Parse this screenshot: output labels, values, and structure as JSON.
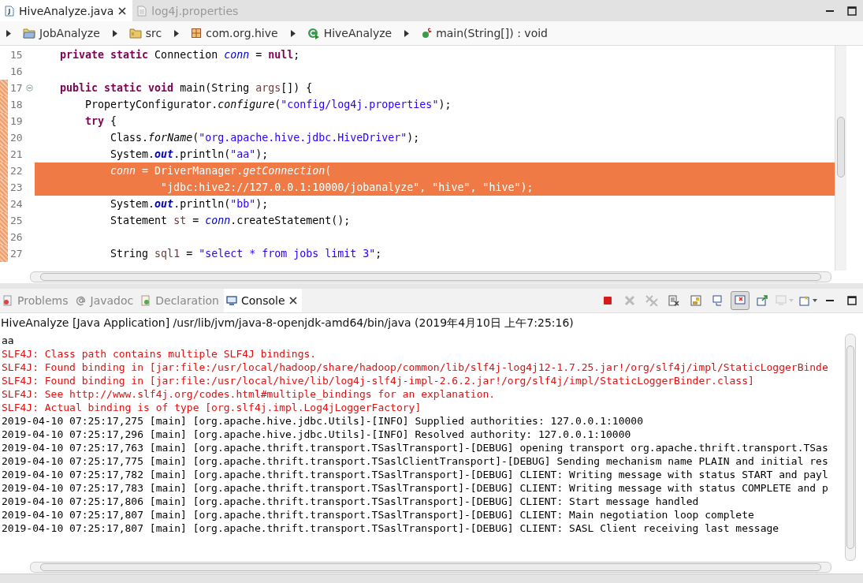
{
  "editor_tabs": [
    {
      "label": "HiveAnalyze.java",
      "selected": true,
      "kind": "java"
    },
    {
      "label": "log4j.properties",
      "selected": false,
      "kind": "file"
    }
  ],
  "breadcrumb": [
    {
      "label": "JobAnalyze",
      "kind": "project"
    },
    {
      "label": "src",
      "kind": "folder"
    },
    {
      "label": "com.org.hive",
      "kind": "package"
    },
    {
      "label": "HiveAnalyze",
      "kind": "class"
    },
    {
      "label": "main(String[]) : void",
      "kind": "method"
    }
  ],
  "code_lines": [
    {
      "number": "15",
      "changed": false,
      "selected": false,
      "foldable": false,
      "tokens": [
        {
          "kind": "kw",
          "t": "    private static"
        },
        {
          "kind": "plain",
          "t": " Connection "
        },
        {
          "kind": "field",
          "t": "conn"
        },
        {
          "kind": "plain",
          "t": " = "
        },
        {
          "kind": "kw",
          "t": "null"
        },
        {
          "kind": "plain",
          "t": ";"
        }
      ]
    },
    {
      "number": "16",
      "changed": false,
      "selected": false,
      "foldable": false
    },
    {
      "number": "17",
      "changed": true,
      "selected": false,
      "foldable": true,
      "tokens": [
        {
          "kind": "kw",
          "t": "    public static void"
        },
        {
          "kind": "plain",
          "t": " main(String "
        },
        {
          "kind": "local",
          "t": "args"
        },
        {
          "kind": "plain",
          "t": "[]) {"
        }
      ]
    },
    {
      "number": "18",
      "changed": true,
      "selected": false,
      "foldable": false,
      "tokens": [
        {
          "kind": "plain",
          "t": "        PropertyConfigurator."
        },
        {
          "kind": "smethod",
          "t": "configure"
        },
        {
          "kind": "plain",
          "t": "("
        },
        {
          "kind": "str",
          "t": "\"config/log4j.properties\""
        },
        {
          "kind": "plain",
          "t": ");"
        }
      ]
    },
    {
      "number": "19",
      "changed": true,
      "selected": false,
      "foldable": false,
      "tokens": [
        {
          "kind": "kw",
          "t": "        try"
        },
        {
          "kind": "plain",
          "t": " {"
        }
      ]
    },
    {
      "number": "20",
      "changed": true,
      "selected": false,
      "foldable": false,
      "tokens": [
        {
          "kind": "plain",
          "t": "            Class."
        },
        {
          "kind": "smethod",
          "t": "forName"
        },
        {
          "kind": "plain",
          "t": "("
        },
        {
          "kind": "str",
          "t": "\"org.apache.hive.jdbc.HiveDriver\""
        },
        {
          "kind": "plain",
          "t": ");"
        }
      ]
    },
    {
      "number": "21",
      "changed": true,
      "selected": false,
      "foldable": false,
      "tokens": [
        {
          "kind": "plain",
          "t": "            System."
        },
        {
          "kind": "sfield",
          "t": "out"
        },
        {
          "kind": "plain",
          "t": ".println("
        },
        {
          "kind": "str",
          "t": "\"aa\""
        },
        {
          "kind": "plain",
          "t": ");"
        }
      ]
    },
    {
      "number": "22",
      "changed": true,
      "selected": true,
      "foldable": false,
      "tokens": [
        {
          "kind": "field",
          "t": "            conn"
        },
        {
          "kind": "plain",
          "t": " = DriverManager."
        },
        {
          "kind": "smethod",
          "t": "getConnection"
        },
        {
          "kind": "plain",
          "t": "("
        }
      ]
    },
    {
      "number": "23",
      "changed": true,
      "selected": true,
      "foldable": false,
      "tokens": [
        {
          "kind": "str",
          "t": "                    \"jdbc:hive2://127.0.0.1:10000/jobanalyze\""
        },
        {
          "kind": "plain",
          "t": ", "
        },
        {
          "kind": "str",
          "t": "\"hive\""
        },
        {
          "kind": "plain",
          "t": ", "
        },
        {
          "kind": "str",
          "t": "\"hive\""
        },
        {
          "kind": "plain",
          "t": ");"
        }
      ]
    },
    {
      "number": "24",
      "changed": true,
      "selected": false,
      "foldable": false,
      "tokens": [
        {
          "kind": "plain",
          "t": "            System."
        },
        {
          "kind": "sfield",
          "t": "out"
        },
        {
          "kind": "plain",
          "t": ".println("
        },
        {
          "kind": "str",
          "t": "\"bb\""
        },
        {
          "kind": "plain",
          "t": ");"
        }
      ]
    },
    {
      "number": "25",
      "changed": true,
      "selected": false,
      "foldable": false,
      "tokens": [
        {
          "kind": "plain",
          "t": "            Statement "
        },
        {
          "kind": "local",
          "t": "st"
        },
        {
          "kind": "plain",
          "t": " = "
        },
        {
          "kind": "field",
          "t": "conn"
        },
        {
          "kind": "plain",
          "t": ".createStatement();"
        }
      ]
    },
    {
      "number": "26",
      "changed": true,
      "selected": false,
      "foldable": false
    },
    {
      "number": "27",
      "changed": true,
      "selected": false,
      "foldable": false,
      "tokens": [
        {
          "kind": "plain",
          "t": "            String "
        },
        {
          "kind": "local",
          "t": "sql1"
        },
        {
          "kind": "plain",
          "t": " = "
        },
        {
          "kind": "str",
          "t": "\"select * from jobs limit 3\""
        },
        {
          "kind": "plain",
          "t": ";"
        }
      ]
    }
  ],
  "view_tabs": [
    {
      "label": "Problems",
      "selected": false,
      "kind": "problems"
    },
    {
      "label": "Javadoc",
      "selected": false,
      "kind": "javadoc"
    },
    {
      "label": "Declaration",
      "selected": false,
      "kind": "declaration"
    },
    {
      "label": "Console",
      "selected": true,
      "kind": "console"
    }
  ],
  "console_toolbar": [
    {
      "kind": "terminate",
      "disabled": false,
      "pressed": false
    },
    {
      "kind": "remove",
      "disabled": true,
      "pressed": false
    },
    {
      "kind": "remove-all",
      "disabled": true,
      "pressed": false
    },
    {
      "kind": "clear",
      "disabled": false,
      "pressed": false
    },
    {
      "kind": "scroll-lock",
      "disabled": false,
      "pressed": false
    },
    {
      "kind": "word-wrap",
      "disabled": false,
      "pressed": false
    },
    {
      "kind": "show-on-output",
      "disabled": false,
      "pressed": true
    },
    {
      "kind": "pin",
      "disabled": false,
      "pressed": false
    },
    {
      "kind": "display",
      "disabled": true,
      "pressed": false
    },
    {
      "kind": "new-console",
      "disabled": false,
      "pressed": false
    }
  ],
  "console_description": "HiveAnalyze [Java Application] /usr/lib/jvm/java-8-openjdk-amd64/bin/java (2019年4月10日 上午7:25:16)",
  "console_lines": [
    {
      "kind": "out",
      "text": "aa"
    },
    {
      "kind": "err",
      "text": "SLF4J: Class path contains multiple SLF4J bindings."
    },
    {
      "kind": "err",
      "text": "SLF4J: Found binding in [jar:file:/usr/local/hadoop/share/hadoop/common/lib/slf4j-log4j12-1.7.25.jar!/org/slf4j/impl/StaticLoggerBinde"
    },
    {
      "kind": "err",
      "text": "SLF4J: Found binding in [jar:file:/usr/local/hive/lib/log4j-slf4j-impl-2.6.2.jar!/org/slf4j/impl/StaticLoggerBinder.class]"
    },
    {
      "kind": "err",
      "text": "SLF4J: See http://www.slf4j.org/codes.html#multiple_bindings for an explanation."
    },
    {
      "kind": "err",
      "text": "SLF4J: Actual binding is of type [org.slf4j.impl.Log4jLoggerFactory]"
    },
    {
      "kind": "out",
      "text": "2019-04-10 07:25:17,275 [main] [org.apache.hive.jdbc.Utils]-[INFO] Supplied authorities: 127.0.0.1:10000"
    },
    {
      "kind": "out",
      "text": "2019-04-10 07:25:17,296 [main] [org.apache.hive.jdbc.Utils]-[INFO] Resolved authority: 127.0.0.1:10000"
    },
    {
      "kind": "out",
      "text": "2019-04-10 07:25:17,763 [main] [org.apache.thrift.transport.TSaslTransport]-[DEBUG] opening transport org.apache.thrift.transport.TSas"
    },
    {
      "kind": "out",
      "text": "2019-04-10 07:25:17,775 [main] [org.apache.thrift.transport.TSaslClientTransport]-[DEBUG] Sending mechanism name PLAIN and initial res"
    },
    {
      "kind": "out",
      "text": "2019-04-10 07:25:17,782 [main] [org.apache.thrift.transport.TSaslTransport]-[DEBUG] CLIENT: Writing message with status START and payl"
    },
    {
      "kind": "out",
      "text": "2019-04-10 07:25:17,783 [main] [org.apache.thrift.transport.TSaslTransport]-[DEBUG] CLIENT: Writing message with status COMPLETE and p"
    },
    {
      "kind": "out",
      "text": "2019-04-10 07:25:17,806 [main] [org.apache.thrift.transport.TSaslTransport]-[DEBUG] CLIENT: Start message handled"
    },
    {
      "kind": "out",
      "text": "2019-04-10 07:25:17,807 [main] [org.apache.thrift.transport.TSaslTransport]-[DEBUG] CLIENT: Main negotiation loop complete"
    },
    {
      "kind": "out",
      "text": "2019-04-10 07:25:17,807 [main] [org.apache.thrift.transport.TSaslTransport]-[DEBUG] CLIENT: SASL Client receiving last message"
    }
  ]
}
